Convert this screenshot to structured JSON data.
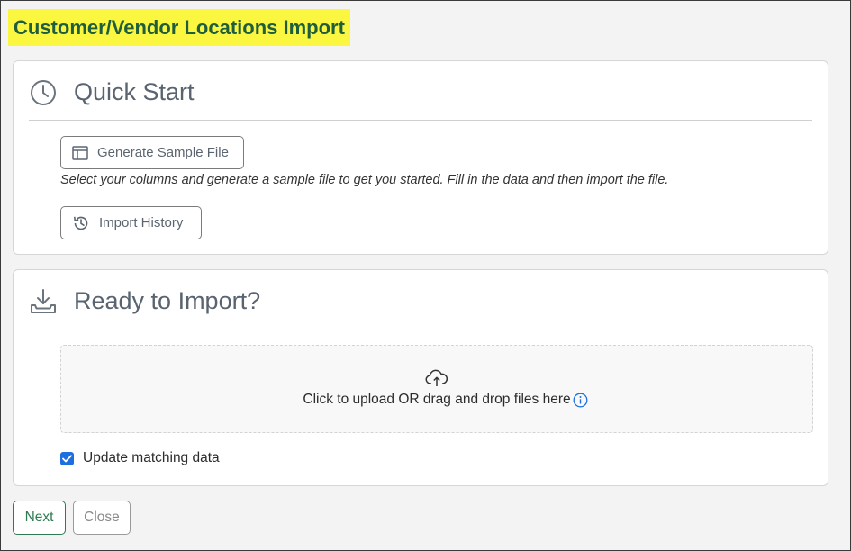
{
  "page": {
    "title": "Customer/Vendor Locations Import"
  },
  "quick_start": {
    "icon": "clock-icon",
    "title": "Quick Start",
    "generate_button_label": "Generate Sample File",
    "generate_icon": "table-icon",
    "help_text": "Select your columns and generate a sample file to get you started. Fill in the data and then import the file.",
    "history_button_label": "Import History",
    "history_icon": "history-icon"
  },
  "ready": {
    "icon": "download-tray-icon",
    "title": "Ready to Import?",
    "dropzone_text": "Click to upload OR drag and drop files here",
    "upload_icon": "cloud-upload-icon",
    "info_icon": "info-icon",
    "checkbox_label": "Update matching data",
    "checkbox_checked": true
  },
  "footer": {
    "next_label": "Next",
    "close_label": "Close"
  },
  "colors": {
    "title_highlight": "#fbf63f",
    "title_text": "#1f5e3c",
    "primary_outline": "#2f7a52",
    "checkbox": "#1d6fe0",
    "info": "#1d6fe0"
  }
}
